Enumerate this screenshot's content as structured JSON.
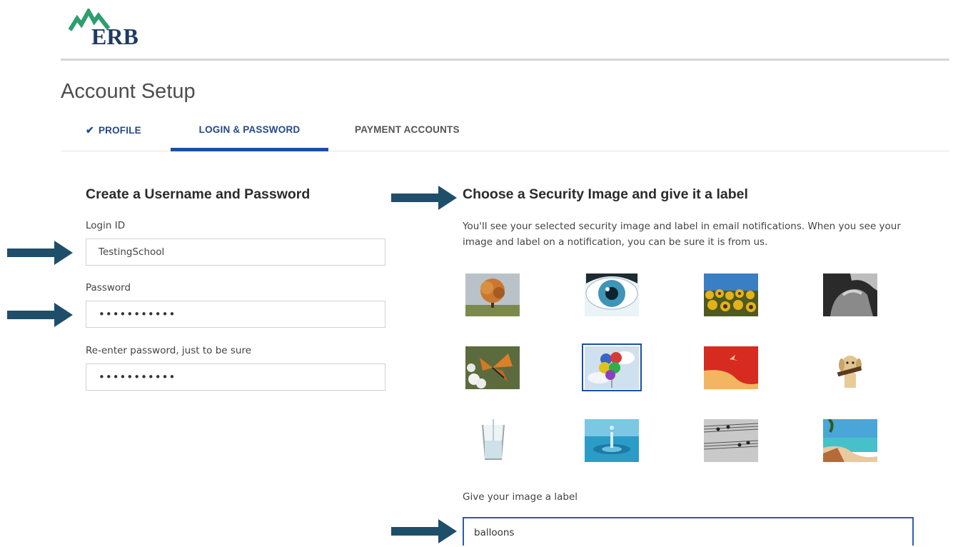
{
  "brand": {
    "logo_text": "ERB",
    "colors": {
      "navy": "#1e3a62",
      "green": "#2e9e6e",
      "accent_blue": "#1c4fa3"
    }
  },
  "page": {
    "title": "Account Setup"
  },
  "tabs": [
    {
      "label": "PROFILE",
      "state": "completed",
      "icon": "checkmark-icon"
    },
    {
      "label": "LOGIN & PASSWORD",
      "state": "active"
    },
    {
      "label": "PAYMENT ACCOUNTS",
      "state": "inactive"
    }
  ],
  "credentials": {
    "heading": "Create a Username and Password",
    "login_id_label": "Login ID",
    "login_id_value": "TestingSchool",
    "password_label": "Password",
    "password_value": "•••••••••••",
    "reenter_label": "Re-enter password, just to be sure",
    "reenter_value": "•••••••••••"
  },
  "security": {
    "heading": "Choose a Security Image and give it a label",
    "description": "You'll see your selected security image and label in email notifications. When you see your image and label on a notification, you can be sure it is from us.",
    "images": [
      "autumn-tree",
      "blue-eye",
      "sunflowers",
      "hands",
      "butterfly",
      "balloons",
      "red-bird-art",
      "dog-with-stick",
      "water-glass",
      "water-drop",
      "sheet-music",
      "beach"
    ],
    "selected_image": "balloons",
    "label_prompt": "Give your image a label",
    "label_value": "balloons"
  },
  "annotations": {
    "arrow_color": "#1f4e6b",
    "icon": "arrow-right-icon"
  }
}
